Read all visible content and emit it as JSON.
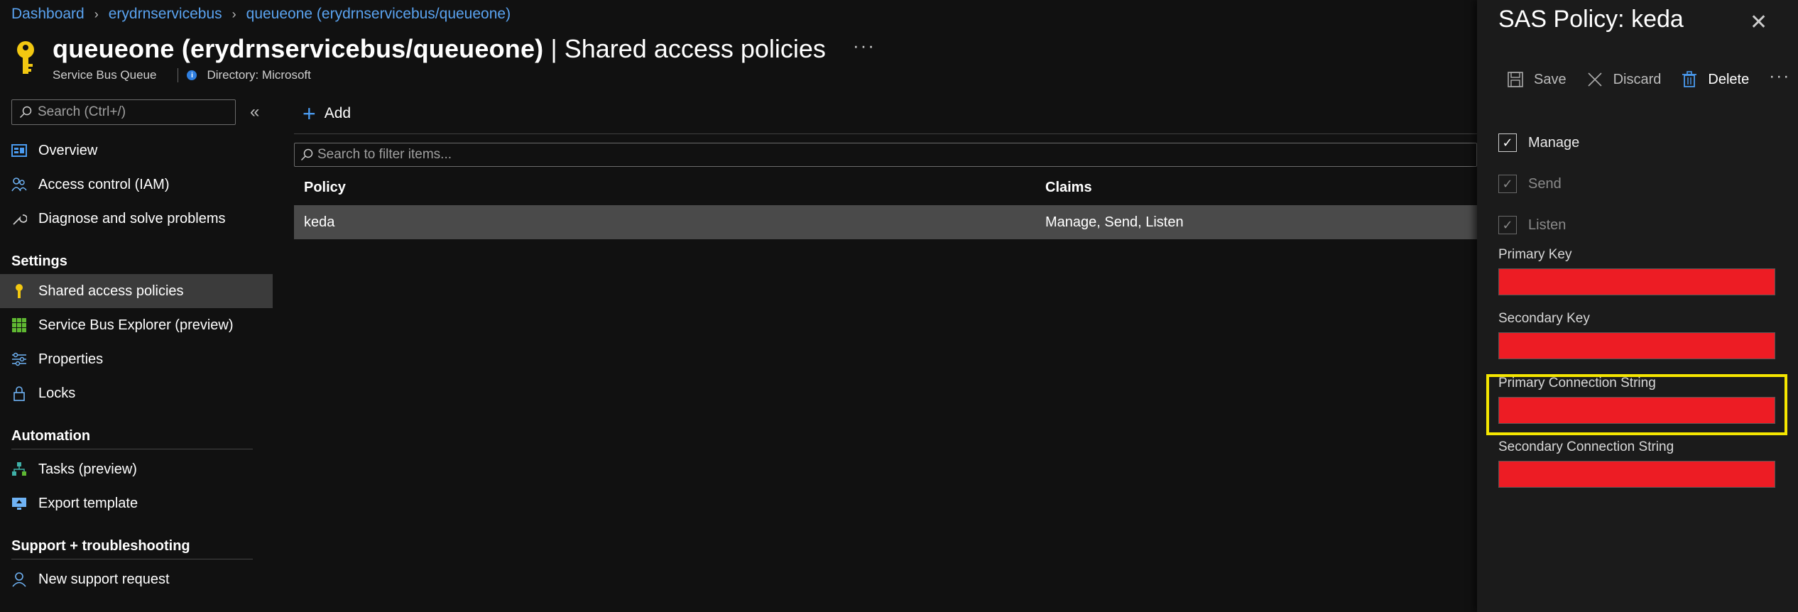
{
  "breadcrumb": [
    "Dashboard",
    "erydrnservicebus",
    "queueone (erydrnservicebus/queueone)"
  ],
  "header": {
    "title": "queueone (erydrnservicebus/queueone)",
    "title_suffix": "| Shared access policies",
    "resource_type": "Service Bus Queue",
    "directory": "Directory: Microsoft",
    "more": "···"
  },
  "sidebar": {
    "search_placeholder": "Search (Ctrl+/)",
    "collapse": "«",
    "items": [
      {
        "label": "Overview",
        "icon": "overview-icon"
      },
      {
        "label": "Access control (IAM)",
        "icon": "iam-people-icon"
      },
      {
        "label": "Diagnose and solve problems",
        "icon": "wrench-icon"
      }
    ],
    "sections": [
      {
        "title": "Settings",
        "items": [
          {
            "label": "Shared access policies",
            "icon": "key-icon",
            "active": true
          },
          {
            "label": "Service Bus Explorer (preview)",
            "icon": "grid-icon"
          },
          {
            "label": "Properties",
            "icon": "sliders-icon"
          },
          {
            "label": "Locks",
            "icon": "lock-icon"
          }
        ]
      },
      {
        "title": "Automation",
        "items": [
          {
            "label": "Tasks (preview)",
            "icon": "tasks-icon"
          },
          {
            "label": "Export template",
            "icon": "export-icon"
          }
        ]
      },
      {
        "title": "Support + troubleshooting",
        "items": [
          {
            "label": "New support request",
            "icon": "support-person-icon"
          }
        ]
      }
    ]
  },
  "main": {
    "add_label": "Add",
    "filter_placeholder": "Search to filter items...",
    "columns": [
      "Policy",
      "Claims"
    ],
    "rows": [
      {
        "policy": "keda",
        "claims": "Manage, Send, Listen"
      }
    ]
  },
  "panel": {
    "title": "SAS Policy: keda",
    "close": "✕",
    "toolbar": {
      "save": "Save",
      "discard": "Discard",
      "delete": "Delete",
      "more": "···"
    },
    "checks": [
      {
        "label": "Manage",
        "checked": true,
        "disabled": false
      },
      {
        "label": "Send",
        "checked": true,
        "disabled": true
      },
      {
        "label": "Listen",
        "checked": true,
        "disabled": true
      }
    ],
    "fields": {
      "primary_key": "Primary Key",
      "secondary_key": "Secondary Key",
      "primary_conn": "Primary Connection String",
      "secondary_conn": "Secondary Connection String"
    },
    "redaction_color": "#ed1c24",
    "highlight_color": "#f5e600"
  }
}
